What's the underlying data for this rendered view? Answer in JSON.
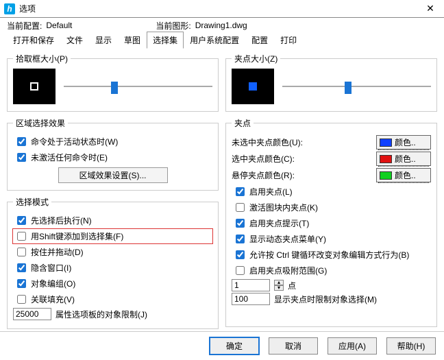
{
  "window": {
    "title": "选项",
    "close": "✕"
  },
  "config": {
    "curr_label": "当前配置:",
    "curr_value": "Default",
    "drawing_label": "当前图形:",
    "drawing_value": "Drawing1.dwg"
  },
  "tabs": {
    "openSave": "打开和保存",
    "file": "文件",
    "display": "显示",
    "draft": "草图",
    "selection": "选择集",
    "usersys": "用户系统配置",
    "configure": "配置",
    "print": "打印"
  },
  "left": {
    "pickbox": {
      "legend": "拾取框大小(P)"
    },
    "region": {
      "legend": "区域选择效果",
      "activeCmd": "命令处于活动状态时(W)",
      "noCmd": "未激活任何命令时(E)",
      "settingsBtn": "区域效果设置(S)..."
    },
    "mode": {
      "legend": "选择模式",
      "m1": "先选择后执行(N)",
      "m2": "用Shift键添加到选择集(F)",
      "m3": "按住并拖动(D)",
      "m4": "隐含窗口(I)",
      "m5": "对象编组(O)",
      "m6": "关联填充(V)",
      "limitValue": "25000",
      "limitLabel": "属性选项板的对象限制(J)"
    }
  },
  "right": {
    "gripsize": {
      "legend": "夹点大小(Z)"
    },
    "grips": {
      "legend": "夹点",
      "unselColorLabel": "未选中夹点颜色(U):",
      "selColorLabel": "选中夹点颜色(C):",
      "hoverColorLabel": "悬停夹点颜色(R):",
      "colorBtn": "颜色..",
      "g1": "启用夹点(L)",
      "g2": "激活图块内夹点(K)",
      "g3": "启用夹点提示(T)",
      "g4": "显示动态夹点菜单(Y)",
      "g5": "允许按 Ctrl 键循环改变对象编辑方式行为(B)",
      "g6": "启用夹点吸附范围(G)",
      "snapValue": "1",
      "snapLabel": "点",
      "dispLimitValue": "100",
      "dispLimitLabel": "显示夹点时限制对象选择(M)"
    },
    "colors": {
      "unsel": "#1040ff",
      "sel": "#e01010",
      "hover": "#10d020"
    }
  },
  "footer": {
    "ok": "确定",
    "cancel": "取消",
    "apply": "应用(A)",
    "help": "帮助(H)"
  }
}
